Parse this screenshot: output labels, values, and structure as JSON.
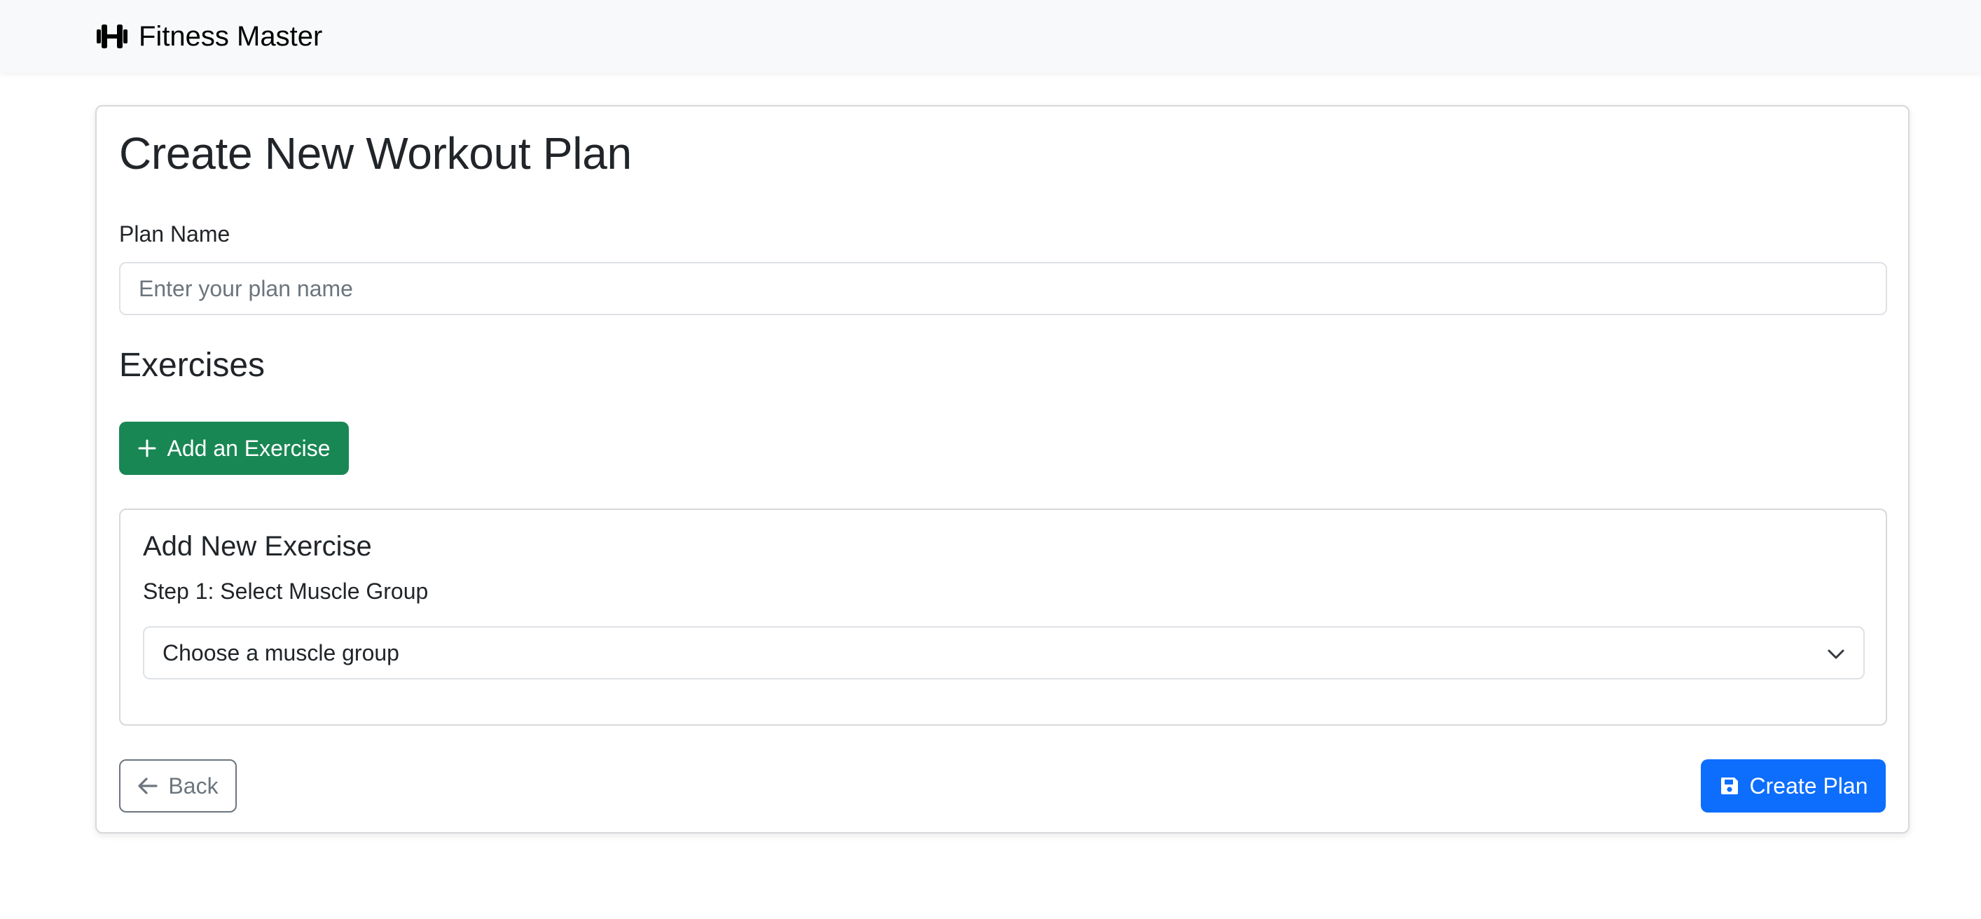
{
  "navbar": {
    "brand_icon": "dumbbell-icon",
    "brand_text": "Fitness Master"
  },
  "form": {
    "title": "Create New Workout Plan",
    "plan_name_label": "Plan Name",
    "plan_name_placeholder": "Enter your plan name",
    "plan_name_value": "",
    "exercises_heading": "Exercises",
    "add_exercise_button": {
      "icon": "plus-icon",
      "label": "Add an Exercise",
      "color": "#198754"
    },
    "new_exercise": {
      "title": "Add New Exercise",
      "step_label": "Step 1: Select Muscle Group",
      "muscle_group_select": {
        "selected": "Choose a muscle group",
        "icon": "chevron-down-icon"
      }
    },
    "back_button": {
      "icon": "arrow-left-icon",
      "label": "Back",
      "color": "#6c757d"
    },
    "create_button": {
      "icon": "save-icon",
      "label": "Create Plan",
      "color": "#0d6efd"
    }
  }
}
